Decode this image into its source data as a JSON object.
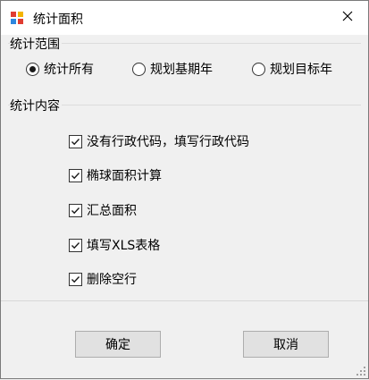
{
  "window": {
    "title": "统计面积",
    "icon": "app-grid-icon",
    "close_icon": "close-icon"
  },
  "scope": {
    "label": "统计范围",
    "options": [
      {
        "label": "统计所有",
        "checked": true
      },
      {
        "label": "规划基期年",
        "checked": false
      },
      {
        "label": "规划目标年",
        "checked": false
      }
    ]
  },
  "content": {
    "label": "统计内容",
    "items": [
      {
        "label": "没有行政代码，填写行政代码",
        "checked": true
      },
      {
        "label": "椭球面积计算",
        "checked": true
      },
      {
        "label": "汇总面积",
        "checked": true
      },
      {
        "label": "填写XLS表格",
        "checked": true
      },
      {
        "label": "删除空行",
        "checked": true
      }
    ]
  },
  "buttons": {
    "ok": "确定",
    "cancel": "取消"
  }
}
